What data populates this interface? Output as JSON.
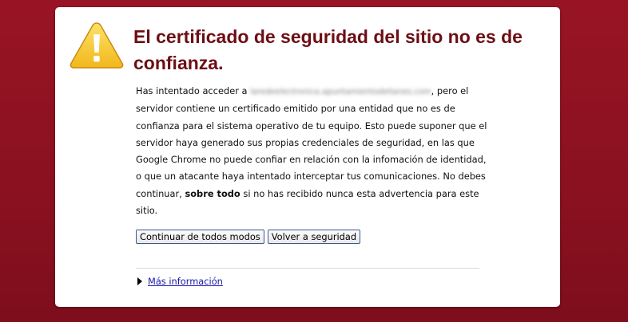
{
  "warning": {
    "icon": "warning-triangle-icon",
    "title": "El certificado de seguridad del sitio no es de confianza.",
    "body": {
      "intro": "Has intentado acceder a",
      "blurred_host": "laredeelectronica.apuntamientodelianes.com",
      "part1": ", pero el servidor contiene un certificado emitido por una entidad que no es de confianza para el sistema operativo de tu equipo. Esto puede suponer que el servidor haya generado sus propias credenciales de seguridad, en las que Google Chrome no puede confiar en relación con la infomación de identidad, o que un atacante haya intentado interceptar tus comunicaciones. No debes continuar,",
      "emphasis": "sobre todo",
      "part2": "si no has recibido nunca esta advertencia para este sitio."
    },
    "buttons": {
      "proceed": "Continuar de todos modos",
      "back": "Volver a seguridad"
    },
    "more_info": "Más información"
  },
  "colors": {
    "background": "#8e1220",
    "title": "#6d0e14",
    "link": "#1a1aa6"
  }
}
